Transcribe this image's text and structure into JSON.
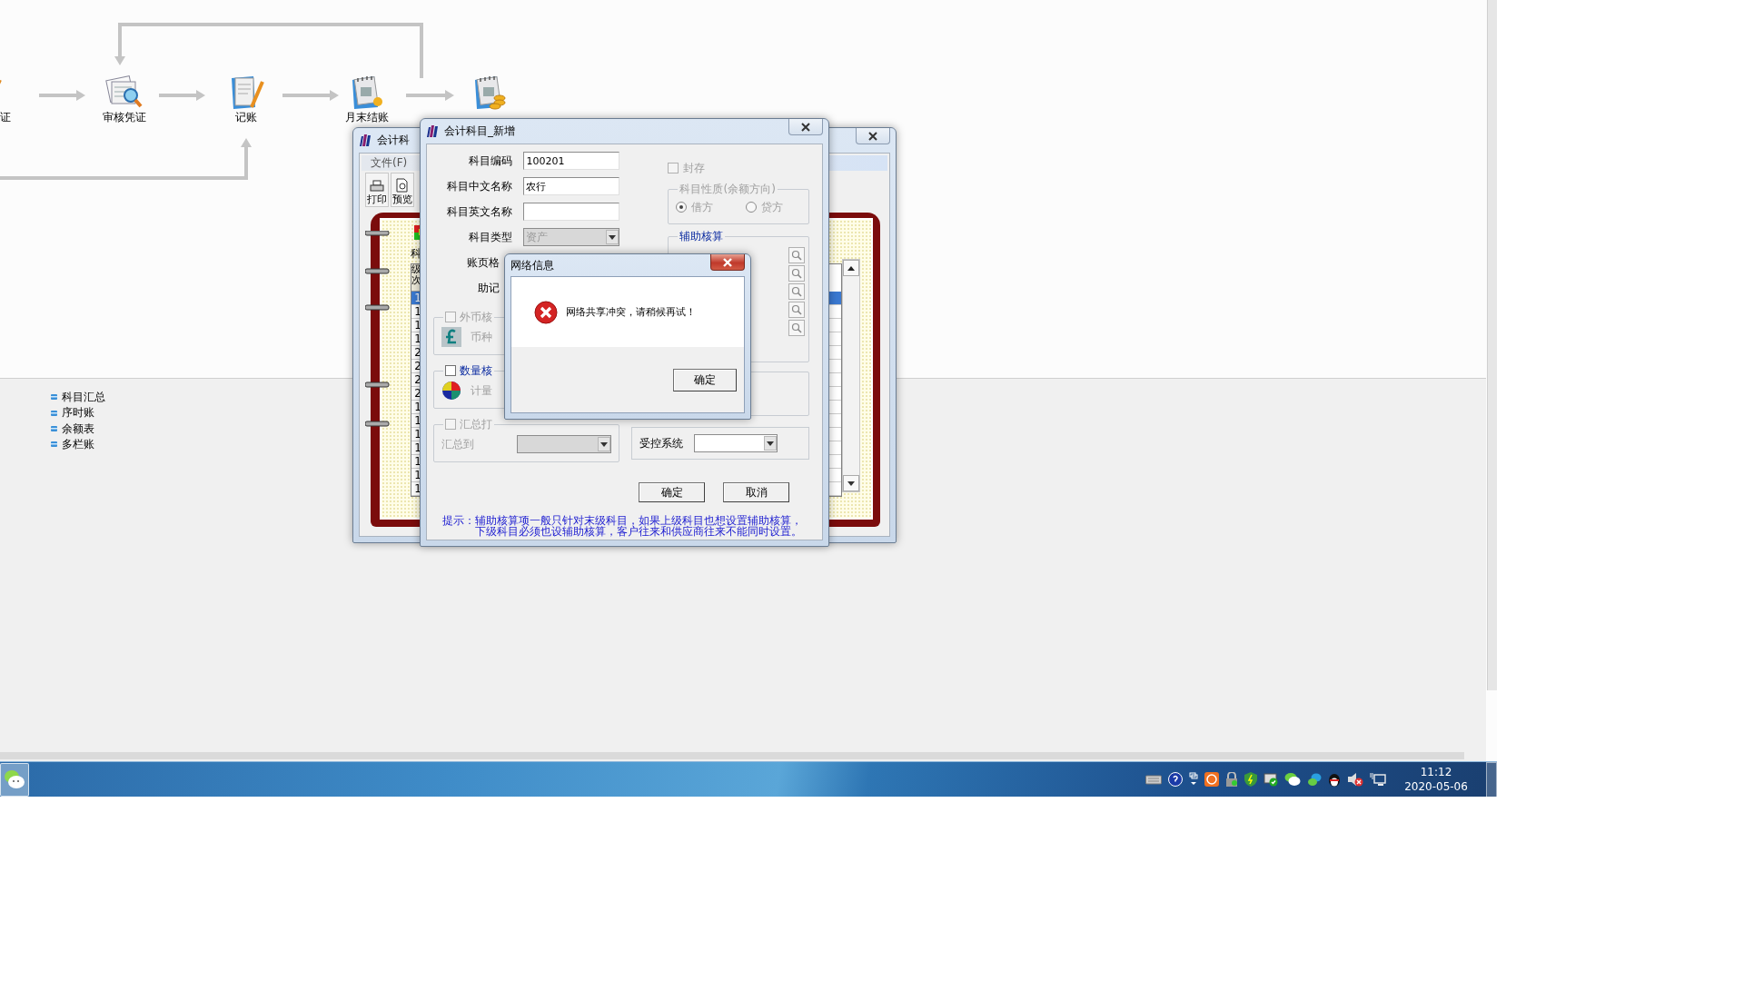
{
  "flow": {
    "steps": [
      {
        "kind": "voucher",
        "label": "证"
      },
      {
        "kind": "audit",
        "label": "审核凭证"
      },
      {
        "kind": "post",
        "label": "记账"
      },
      {
        "kind": "close",
        "label": "月末结账"
      },
      {
        "kind": "close-coins"
      }
    ]
  },
  "report_links": [
    "科目汇总",
    "序时账",
    "余额表",
    "多栏账"
  ],
  "back_window": {
    "title": "会计科",
    "menu": [
      "文件(F)"
    ],
    "toolbar": [
      {
        "kind": "print",
        "label": "打印"
      },
      {
        "kind": "preview",
        "label": "预览"
      }
    ],
    "page_label": "科",
    "column_header": "级次",
    "rows": [
      {
        "value": "1",
        "selected": true
      },
      {
        "value": "1",
        "selected": false
      },
      {
        "value": "1",
        "selected": false
      },
      {
        "value": "1",
        "selected": false
      },
      {
        "value": "2",
        "selected": false
      },
      {
        "value": "2",
        "selected": false
      },
      {
        "value": "2",
        "selected": false
      },
      {
        "value": "2",
        "selected": false
      },
      {
        "value": "1",
        "selected": false
      },
      {
        "value": "1",
        "selected": false
      },
      {
        "value": "1",
        "selected": false
      },
      {
        "value": "1",
        "selected": false
      },
      {
        "value": "1",
        "selected": false
      },
      {
        "value": "1",
        "selected": false
      },
      {
        "value": "1",
        "selected": false
      }
    ]
  },
  "dialog": {
    "title": "会计科目_新增",
    "fields": [
      {
        "kind": "text",
        "label": "科目编码",
        "value": "100201"
      },
      {
        "kind": "text",
        "label": "科目中文名称",
        "value": "农行"
      },
      {
        "kind": "text",
        "label": "科目英文名称"
      },
      {
        "kind": "select",
        "label": "科目类型",
        "value": "资产",
        "disabled": true
      },
      {
        "kind": "label",
        "label": "账页格"
      },
      {
        "kind": "label",
        "label": "助记"
      }
    ],
    "groups": [
      {
        "kind": "currency",
        "label": "外币核",
        "checked": false,
        "disabled": true,
        "sub_label": "币种"
      },
      {
        "kind": "quantity",
        "label": "数量核",
        "checked": false,
        "disabled": false,
        "sub_label": "计量"
      },
      {
        "kind": "summary",
        "label": "汇总打",
        "checked": false,
        "disabled": true,
        "sub_label": "汇总到"
      }
    ],
    "archive": {
      "label": "封存",
      "checked": false
    },
    "nature": {
      "title": "科目性质(余额方向)",
      "disabled": true,
      "options": [
        {
          "label": "借方",
          "selected": true
        },
        {
          "label": "贷方",
          "selected": false
        }
      ]
    },
    "aux": {
      "title": "辅助核算"
    },
    "controlled": {
      "label": "受控系统"
    },
    "buttons": [
      "确定",
      "取消"
    ],
    "hint_lines": [
      "提示：辅助核算项一般只针对末级科目，如果上级科目也想设置辅助核算，",
      "下级科目必须也设辅助核算，客户往来和供应商往来不能同时设置。"
    ]
  },
  "message_box": {
    "title": "网络信息",
    "text": "网络共享冲突，请稍候再试！",
    "button": "确定"
  },
  "taskbar": {
    "time": "11:12",
    "date": "2020-05-06"
  }
}
